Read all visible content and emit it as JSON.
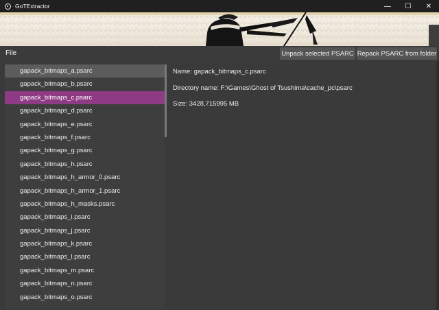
{
  "window": {
    "title": "GoTExtractor",
    "controls": {
      "minimize": "—",
      "maximize": "☐",
      "close": "✕"
    }
  },
  "menu": {
    "file": "File"
  },
  "toolbar": {
    "unpack_label": "Unpack selected PSARC",
    "repack_label": "Repack PSARC from folder"
  },
  "file_list": {
    "items": [
      "gapack_bitmaps_a.psarc",
      "gapack_bitmaps_b.psarc",
      "gapack_bitmaps_c.psarc",
      "gapack_bitmaps_d.psarc",
      "gapack_bitmaps_e.psarc",
      "gapack_bitmaps_f.psarc",
      "gapack_bitmaps_g.psarc",
      "gapack_bitmaps_h.psarc",
      "gapack_bitmaps_h_armor_0.psarc",
      "gapack_bitmaps_h_armor_1.psarc",
      "gapack_bitmaps_h_masks.psarc",
      "gapack_bitmaps_i.psarc",
      "gapack_bitmaps_j.psarc",
      "gapack_bitmaps_k.psarc",
      "gapack_bitmaps_l.psarc",
      "gapack_bitmaps_m.psarc",
      "gapack_bitmaps_n.psarc",
      "gapack_bitmaps_o.psarc"
    ],
    "hovered_index": 0,
    "selected_index": 2
  },
  "details": {
    "name": "Name: gapack_bitmaps_c.psarc",
    "directory": "Directory name: F:\\Games\\Ghost of Tsushima\\cache_pc\\psarc",
    "size": "Size: 3428,715995 MB"
  },
  "colors": {
    "selection": "#8e3a84",
    "background": "#3a3a3a",
    "button": "#545454"
  }
}
